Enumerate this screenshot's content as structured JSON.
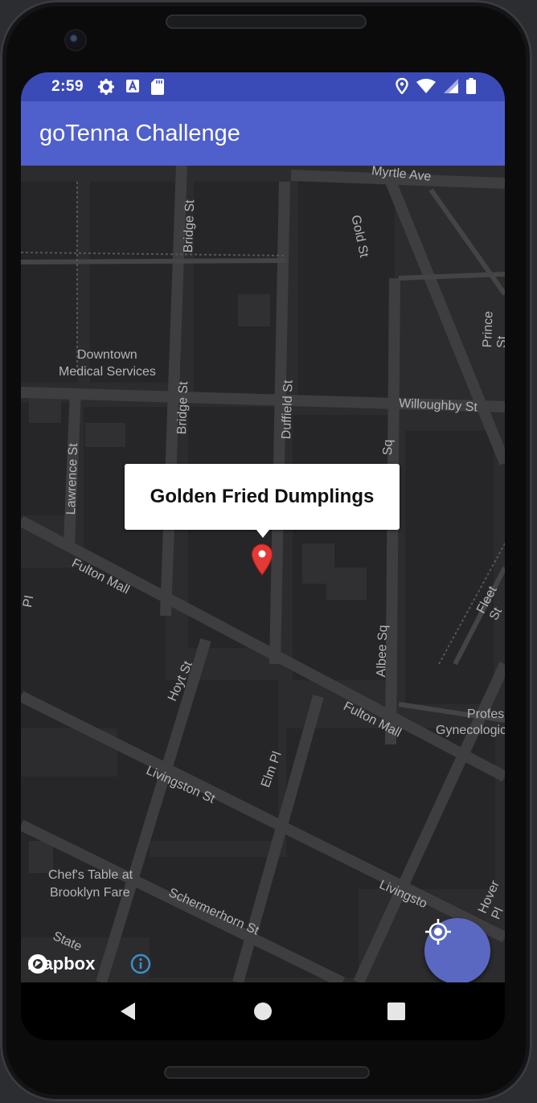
{
  "status_bar": {
    "time": "2:59",
    "left_icons": [
      "settings-icon",
      "a-icon",
      "sd-card-icon"
    ],
    "right_icons": [
      "location-icon",
      "wifi-icon",
      "signal-icon",
      "battery-icon"
    ]
  },
  "app_bar": {
    "title": "goTenna Challenge"
  },
  "map": {
    "theme": "dark",
    "labels": {
      "myrtle_ave": "Myrtle Ave",
      "gold_st": "Gold St",
      "bridge_st_top": "Bridge St",
      "prince_st": "Prince St",
      "downtown_line1": "Downtown",
      "downtown_line2": "Medical Services",
      "bridge_st_mid": "Bridge St",
      "duffield_st": "Duffield St",
      "willoughby_st": "Willoughby St",
      "lawrence_st": "Lawrence St",
      "sq": "Sq",
      "fulton_mall_left": "Fulton Mall",
      "fleet_st": "Fleet St",
      "pl_left": "PI",
      "hoyt_st": "Hoyt St",
      "albee_sq": "Albee Sq",
      "fulton_mall_right": "Fulton Mall",
      "profes": "Profes",
      "gynecologic": "Gynecologic",
      "livingston_st_left": "Livingston St",
      "elm_pl": "Elm Pl",
      "chefs_line1": "Chef's Table at",
      "chefs_line2": "Brooklyn Fare",
      "schermerhorn_st": "Schermerhorn St",
      "livingston_st_right": "Livingsto",
      "hover_pl": "Hover Pl",
      "state_st": "State"
    },
    "popup_title": "Golden Fried Dumplings",
    "marker_color": "#e53935",
    "attribution": "mapbox"
  },
  "fab": {
    "icon": "my-location-icon",
    "color": "#5b68c2"
  },
  "nav_bar": {
    "icons": [
      "back-icon",
      "home-icon",
      "recents-icon"
    ]
  },
  "colors": {
    "status_bar": "#3a4bb8",
    "app_bar": "#4f60cc",
    "map_bg": "#2c2c2e",
    "road": "#3d3d40"
  }
}
